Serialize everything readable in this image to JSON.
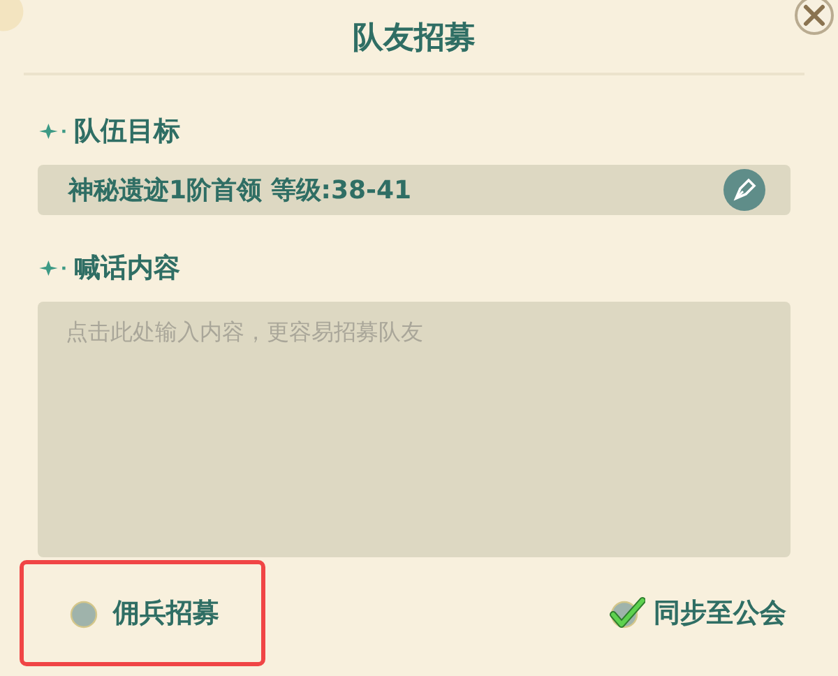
{
  "title": "队友招募",
  "target": {
    "heading": "队伍目标",
    "value": "神秘遗迹1阶首领 等级:38-41"
  },
  "message": {
    "heading": "喊话内容",
    "placeholder": "点击此处输入内容，更容易招募队友"
  },
  "options": [
    {
      "label": "佣兵招募",
      "checked": false,
      "highlighted": true
    },
    {
      "label": "同步至公会",
      "checked": true,
      "highlighted": false
    }
  ]
}
